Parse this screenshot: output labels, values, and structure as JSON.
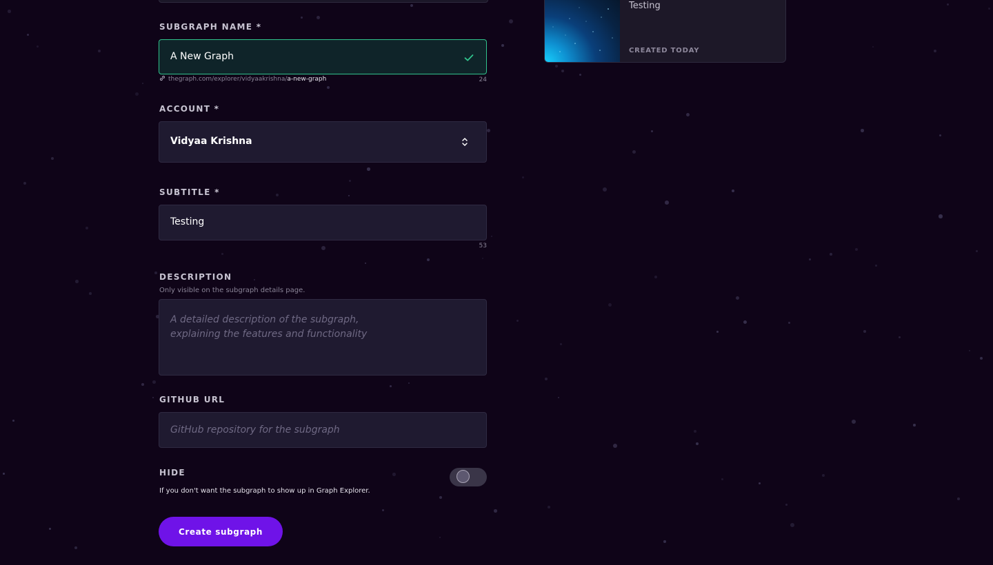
{
  "form": {
    "subgraph_name": {
      "label": "SUBGRAPH NAME *",
      "value": "A New Graph",
      "url_prefix": "thegraph.com/explorer/vidyaakrishna/",
      "url_slug": "a-new-graph",
      "char_count": "24"
    },
    "account": {
      "label": "ACCOUNT *",
      "value": "Vidyaa Krishna"
    },
    "subtitle": {
      "label": "SUBTITLE *",
      "value": "Testing",
      "char_count": "53"
    },
    "description": {
      "label": "DESCRIPTION",
      "helper": "Only visible on the subgraph details page.",
      "placeholder_line1": "A detailed description of the subgraph,",
      "placeholder_line2": "explaining the features and functionality"
    },
    "github": {
      "label": "GITHUB URL",
      "placeholder": "GitHub repository for the subgraph"
    },
    "hide": {
      "label": "HIDE",
      "description": "If you don't want the subgraph to show up in Graph Explorer.",
      "enabled": false
    },
    "submit_label": "Create subgraph"
  },
  "preview": {
    "subtitle": "Testing",
    "created": "CREATED TODAY"
  },
  "icons": {
    "valid": "check-icon",
    "link": "link-icon",
    "select": "chevron-up-down-icon"
  },
  "colors": {
    "background": "#0f0418",
    "field": "#1f1a30",
    "valid_border": "#30c48d",
    "primary_button": "#6f13e8"
  }
}
